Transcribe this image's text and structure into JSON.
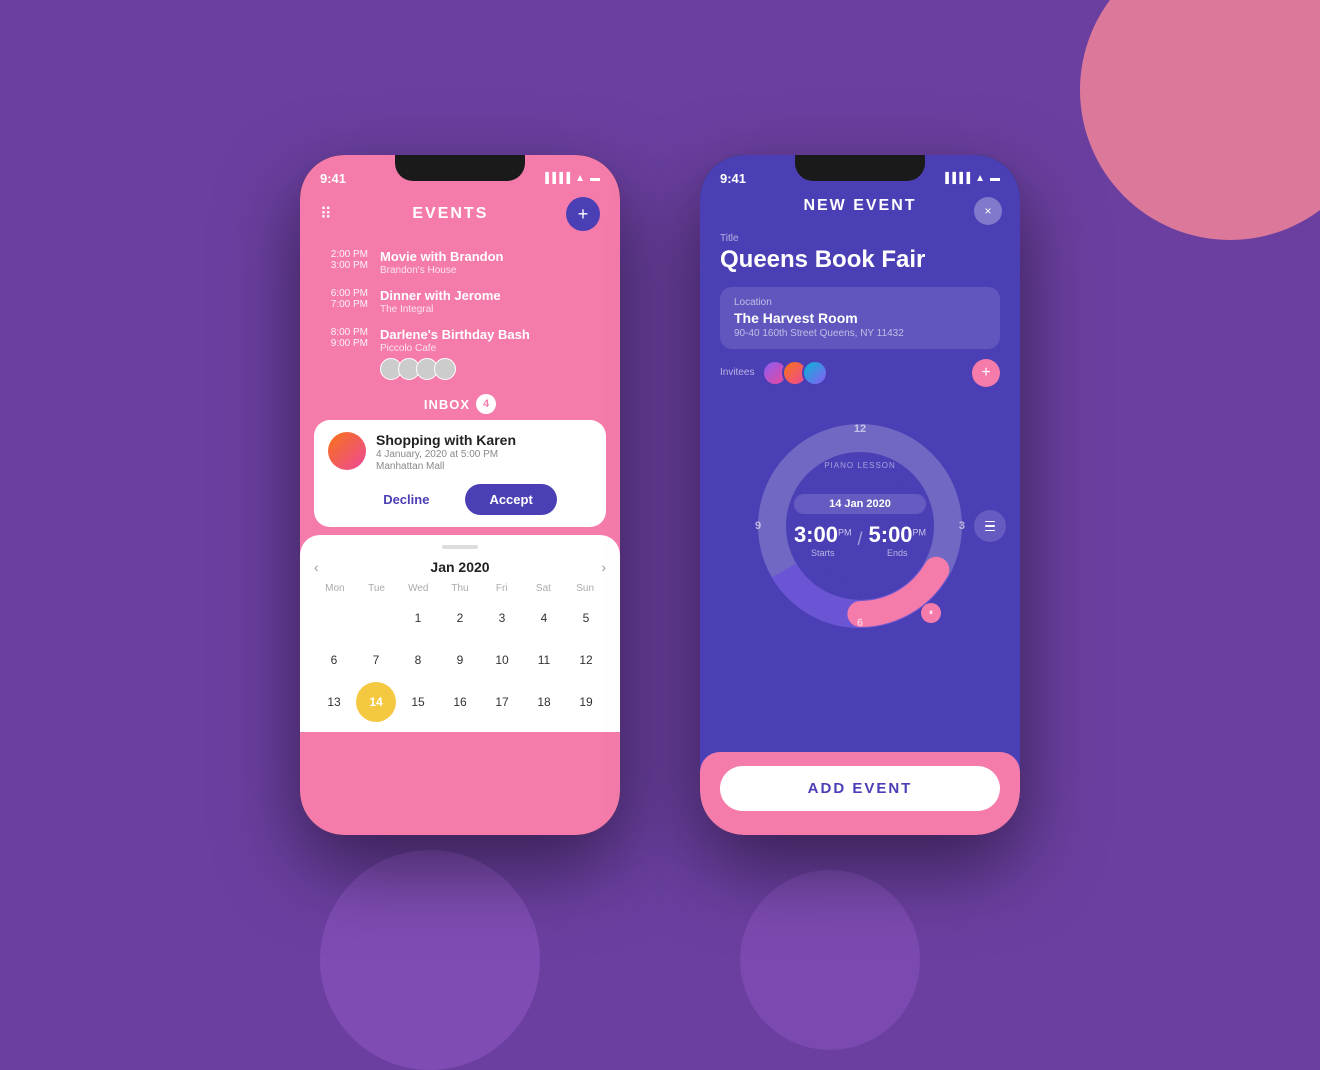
{
  "background": {
    "color": "#6b3fa0"
  },
  "phone1": {
    "status_time": "9:41",
    "header": {
      "title": "EVENTS",
      "add_label": "+"
    },
    "events": [
      {
        "time1": "2:00 PM",
        "time2": "3:00 PM",
        "title": "Movie with Brandon",
        "location": "Brandon's House"
      },
      {
        "time1": "6:00 PM",
        "time2": "7:00 PM",
        "title": "Dinner with Jerome",
        "location": "The Integral"
      },
      {
        "time1": "8:00 PM",
        "time2": "9:00 PM",
        "title": "Darlene's Birthday Bash",
        "location": "Piccolo Cafe"
      }
    ],
    "inbox": {
      "label": "INBOX",
      "count": "4",
      "card": {
        "title": "Shopping with Karen",
        "date": "4 January, 2020 at 5:00 PM",
        "location": "Manhattan Mall",
        "decline_label": "Decline",
        "accept_label": "Accept"
      }
    },
    "calendar": {
      "month": "Jan 2020",
      "days_header": [
        "Mon",
        "Tue",
        "Wed",
        "Thu",
        "Fri",
        "Sat",
        "Sun"
      ],
      "today": "14",
      "rows": [
        [
          "",
          "",
          "1",
          "2",
          "3",
          "4",
          "5"
        ],
        [
          "6",
          "7",
          "8",
          "9",
          "10",
          "11",
          "12"
        ],
        [
          "13",
          "14",
          "15",
          "16",
          "17",
          "18",
          "19"
        ]
      ]
    }
  },
  "phone2": {
    "status_time": "9:41",
    "header": {
      "title": "NEW EVENT",
      "close_label": "×"
    },
    "form": {
      "title_label": "Title",
      "event_name": "Queens Book Fair",
      "location_label": "Location",
      "location_name": "The Harvest Room",
      "location_addr": "90-40 160th Street Queens, NY 11432",
      "invitees_label": "Invitees"
    },
    "clock": {
      "date": "14 Jan 2020",
      "start_time": "3:00",
      "start_period": "PM",
      "start_label": "Starts",
      "end_time": "5:00",
      "end_period": "PM",
      "end_label": "Ends",
      "piano_lesson_label": "PIANO LESSON",
      "num_12": "12",
      "num_3": "3",
      "num_6": "6",
      "num_9": "9"
    },
    "add_event_label": "ADD EVENT"
  }
}
